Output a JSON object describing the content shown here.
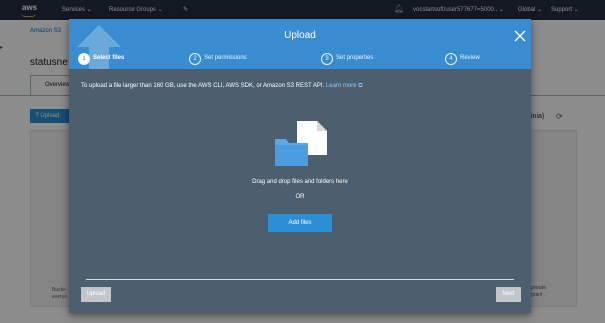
{
  "topbar": {
    "logo": "aws",
    "services": "Services",
    "resource_groups": "Resource Groups",
    "pin": "✎",
    "account": "vocstartsoft/user577677=5000..",
    "region": "Global",
    "support": "Support"
  },
  "background": {
    "breadcrumb": "Amazon S3",
    "bucket_title": "statusne",
    "tab": "Overview",
    "upload_button": "Upload",
    "region_fragment": "inia)",
    "note_left": "Bucke\neveryo",
    "note_right": "private,\ngrant"
  },
  "modal": {
    "title": "Upload",
    "steps": [
      {
        "num": "1",
        "label": "Select files",
        "active": true
      },
      {
        "num": "2",
        "label": "Set permissions",
        "active": false
      },
      {
        "num": "3",
        "label": "Set properties",
        "active": false
      },
      {
        "num": "4",
        "label": "Review",
        "active": false
      }
    ],
    "info_text": "To upload a file larger than 160 GB, use the AWS CLI, AWS SDK, or Amazon S3 REST API.",
    "learn_more": "Learn more",
    "drag_text": "Drag and drop files and folders here",
    "or_text": "OR",
    "add_files": "Add files",
    "upload_button": "Upload",
    "next_button": "Next"
  },
  "colors": {
    "header_blue": "#3a8cd0",
    "modal_body": "#4b5f6e",
    "primary_button": "#2b8fd5",
    "disabled_button": "#c2c6c9",
    "topbar": "#232f3e"
  },
  "icons": [
    "close-icon",
    "folder-icon",
    "file-icon",
    "upload-arrow-icon",
    "external-link-icon",
    "refresh-icon",
    "bell-icon"
  ]
}
